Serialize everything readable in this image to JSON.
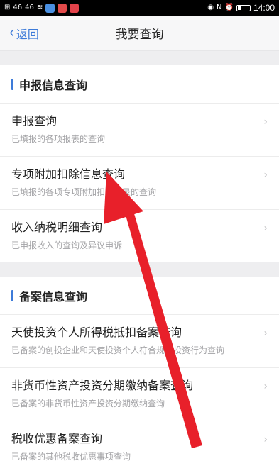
{
  "status_bar": {
    "left_glyphs": [
      "⊞",
      "46",
      "46",
      "≋"
    ],
    "app_icon_colors": [
      "#4a90e2",
      "#e24a4a",
      "#e2424a"
    ],
    "time": "14:00"
  },
  "nav": {
    "back_label": "返回",
    "title": "我要查询"
  },
  "sections": [
    {
      "title": "申报信息查询",
      "items": [
        {
          "title": "申报查询",
          "desc": "已填报的各项报表的查询"
        },
        {
          "title": "专项附加扣除信息查询",
          "desc": "已填报的各项专项附加扣除记录的查询"
        },
        {
          "title": "收入纳税明细查询",
          "desc": "已申报收入的查询及异议申诉"
        }
      ]
    },
    {
      "title": "备案信息查询",
      "items": [
        {
          "title": "天使投资个人所得税抵扣备案查询",
          "desc": "已备案的创投企业和天使投资个人符合规定投资行为查询"
        },
        {
          "title": "非货币性资产投资分期缴纳备案查询",
          "desc": "已备案的非货币性资产投资分期缴纳查询"
        },
        {
          "title": "税收优惠备案查询",
          "desc": "已备案的其他税收优惠事项查询"
        }
      ]
    }
  ],
  "colors": {
    "accent": "#3d7bd9",
    "annotation_arrow": "#e8202a"
  }
}
